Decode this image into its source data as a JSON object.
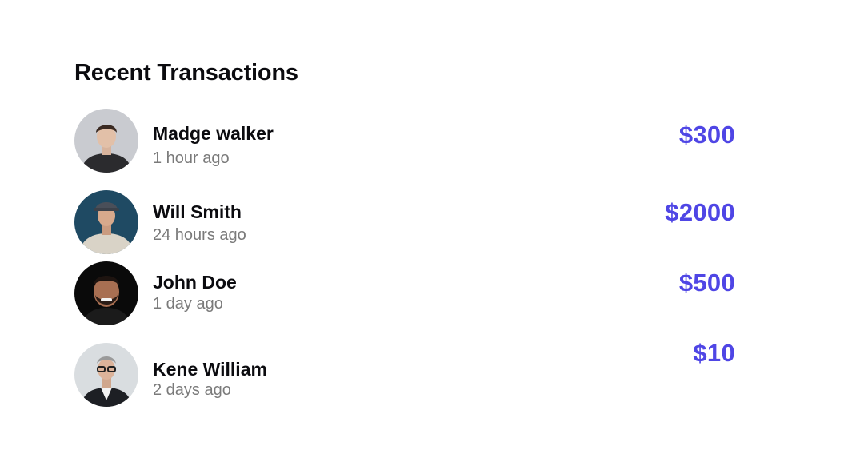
{
  "header": {
    "title": "Recent Transactions"
  },
  "accent_color": "#4f46e5",
  "transactions": [
    {
      "name": "Madge walker",
      "time": "1 hour ago",
      "amount": "$300",
      "avatar_icon": "person-photo"
    },
    {
      "name": "Will Smith",
      "time": "24 hours ago",
      "amount": "$2000",
      "avatar_icon": "person-photo"
    },
    {
      "name": "John Doe",
      "time": "1 day ago",
      "amount": "$500",
      "avatar_icon": "person-photo"
    },
    {
      "name": "Kene William",
      "time": "2 days ago",
      "amount": "$10",
      "avatar_icon": "person-photo"
    }
  ]
}
